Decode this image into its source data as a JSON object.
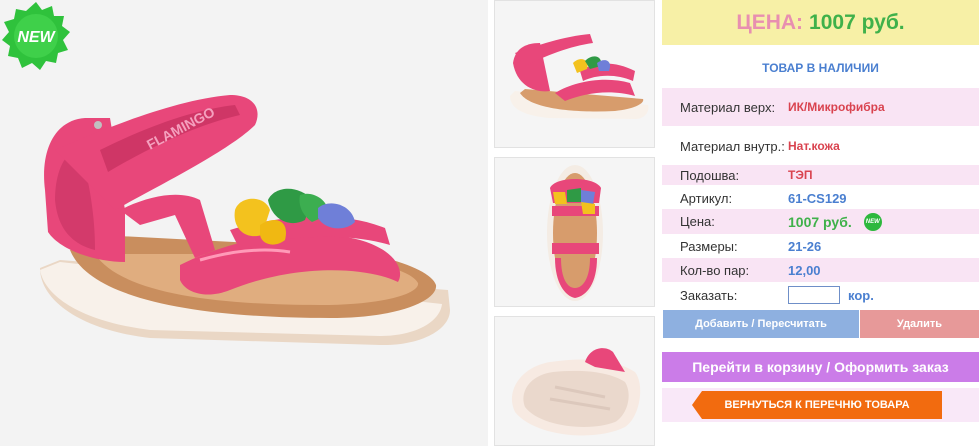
{
  "badge": {
    "new_label": "NEW",
    "mini_new_label": "NEW"
  },
  "price_banner": {
    "label": "ЦЕНА:",
    "value": "1007 руб."
  },
  "stock_status": "ТОВАР В НАЛИЧИИ",
  "specs": [
    {
      "key": "Материал верх:",
      "value": "ИК/Микрофибра"
    },
    {
      "key": "Материал внутр.:",
      "value": "Нат.кожа"
    },
    {
      "key": "Подошва:",
      "value": "ТЭП"
    },
    {
      "key": "Артикул:",
      "value": "61-CS129"
    },
    {
      "key": "Цена:",
      "value": "1007 руб."
    },
    {
      "key": "Размеры:",
      "value": "21-26"
    },
    {
      "key": "Кол-во пар:",
      "value": "12,00"
    }
  ],
  "order": {
    "label": "Заказать:",
    "value": "",
    "unit": "кор."
  },
  "buttons": {
    "add": "Добавить / Пересчитать",
    "delete": "Удалить",
    "cart": "Перейти в корзину / Оформить заказ",
    "back": "ВЕРНУТЬСЯ К ПЕРЕЧНЮ ТОВАРА"
  },
  "product_brand_print": "FLAMINGO",
  "colors": {
    "product_pink": "#e8477a",
    "price_green": "#3fb14a",
    "accent_orange": "#f26b0f"
  }
}
